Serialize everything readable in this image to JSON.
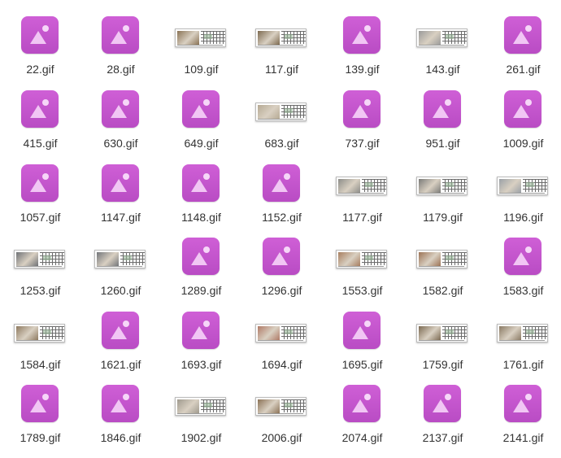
{
  "colors": {
    "icon_top": "#cf5fd6",
    "icon_bottom": "#b94cc4",
    "label_text": "#333333",
    "background": "#ffffff"
  },
  "files": [
    {
      "name": "22.gif",
      "icon": "image-icon"
    },
    {
      "name": "28.gif",
      "icon": "image-icon"
    },
    {
      "name": "109.gif",
      "icon": "thumbnail",
      "photo": "#8a7355"
    },
    {
      "name": "117.gif",
      "icon": "thumbnail",
      "photo": "#7d6a50"
    },
    {
      "name": "139.gif",
      "icon": "image-icon"
    },
    {
      "name": "143.gif",
      "icon": "thumbnail",
      "photo": "#9a9a9a"
    },
    {
      "name": "261.gif",
      "icon": "image-icon"
    },
    {
      "name": "415.gif",
      "icon": "image-icon"
    },
    {
      "name": "630.gif",
      "icon": "image-icon"
    },
    {
      "name": "649.gif",
      "icon": "image-icon"
    },
    {
      "name": "683.gif",
      "icon": "thumbnail",
      "photo": "#b6aa94"
    },
    {
      "name": "737.gif",
      "icon": "image-icon"
    },
    {
      "name": "951.gif",
      "icon": "image-icon"
    },
    {
      "name": "1009.gif",
      "icon": "image-icon"
    },
    {
      "name": "1057.gif",
      "icon": "image-icon"
    },
    {
      "name": "1147.gif",
      "icon": "image-icon"
    },
    {
      "name": "1148.gif",
      "icon": "image-icon"
    },
    {
      "name": "1152.gif",
      "icon": "image-icon"
    },
    {
      "name": "1177.gif",
      "icon": "thumbnail",
      "photo": "#8c8c88"
    },
    {
      "name": "1179.gif",
      "icon": "thumbnail",
      "photo": "#7b7b78"
    },
    {
      "name": "1196.gif",
      "icon": "thumbnail",
      "photo": "#9aa0a6"
    },
    {
      "name": "1253.gif",
      "icon": "thumbnail",
      "photo": "#6f7276"
    },
    {
      "name": "1260.gif",
      "icon": "thumbnail",
      "photo": "#73767a"
    },
    {
      "name": "1289.gif",
      "icon": "image-icon"
    },
    {
      "name": "1296.gif",
      "icon": "image-icon"
    },
    {
      "name": "1553.gif",
      "icon": "thumbnail",
      "photo": "#a77e5f"
    },
    {
      "name": "1582.gif",
      "icon": "thumbnail",
      "photo": "#9c7355"
    },
    {
      "name": "1583.gif",
      "icon": "image-icon"
    },
    {
      "name": "1584.gif",
      "icon": "thumbnail",
      "photo": "#8e7a60"
    },
    {
      "name": "1621.gif",
      "icon": "image-icon"
    },
    {
      "name": "1693.gif",
      "icon": "image-icon"
    },
    {
      "name": "1694.gif",
      "icon": "thumbnail",
      "photo": "#b07a66"
    },
    {
      "name": "1695.gif",
      "icon": "image-icon"
    },
    {
      "name": "1759.gif",
      "icon": "thumbnail",
      "photo": "#7c6a52"
    },
    {
      "name": "1761.gif",
      "icon": "thumbnail",
      "photo": "#8a7a64"
    },
    {
      "name": "1789.gif",
      "icon": "image-icon"
    },
    {
      "name": "1846.gif",
      "icon": "image-icon"
    },
    {
      "name": "1902.gif",
      "icon": "thumbnail",
      "photo": "#9f9a8e"
    },
    {
      "name": "2006.gif",
      "icon": "thumbnail",
      "photo": "#8b7256"
    },
    {
      "name": "2074.gif",
      "icon": "image-icon"
    },
    {
      "name": "2137.gif",
      "icon": "image-icon"
    },
    {
      "name": "2141.gif",
      "icon": "image-icon"
    }
  ]
}
